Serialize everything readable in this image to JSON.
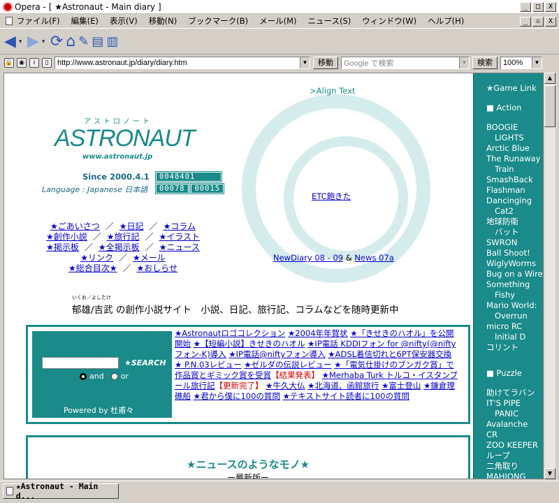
{
  "window": {
    "title": "Opera - [ ★Astronaut - Main diary ]",
    "min": "_",
    "max": "□",
    "close": "X",
    "child_min": "_",
    "child_restore": "▫",
    "child_close": "X"
  },
  "menu": [
    "ファイル(F)",
    "編集(E)",
    "表示(V)",
    "移動(N)",
    "ブックマーク(B)",
    "メール(M)",
    "ニュース(S)",
    "ウィンドウ(W)",
    "ヘルプ(H)"
  ],
  "address": {
    "url": "http://www.astronaut.jp/diary/diary.htm",
    "go_label": "移動",
    "search_placeholder": "Google で検索",
    "search_label": "検索",
    "zoom": "100%"
  },
  "page": {
    "align_text": ">Align Text",
    "logo_text": "ASTRONAUT",
    "logo_kana": "アストロノート",
    "logo_url": "www.astronaut.jp",
    "since": "Since 2000.4.1",
    "counter_total": "0048401",
    "language": "Language : Japanese 日本語",
    "counter_a": "00078",
    "counter_b": "00015",
    "etc_link": "ETC飽きた",
    "newdiary": "NewDiary 08 - 09",
    "amp": "&",
    "news07": "News 07a",
    "nav": [
      [
        "★ごあいさつ",
        "★日記",
        "★コラム"
      ],
      [
        "★創作小説",
        "★旅行記",
        "★イラスト"
      ],
      [
        "★掲示板",
        "★全掲示板",
        "★ニュース"
      ],
      [
        "★リンク",
        "★メール"
      ],
      [
        "★総合目次★",
        "★おしらせ"
      ]
    ],
    "sep": "／",
    "furigana": "いくお／よしたけ",
    "tagline_name": "郁雄/吉武",
    "tagline_rest": "の創作小説サイト　小説、日記、旅行記、コラムなどを随時更新中",
    "search_btn": "★SEARCH",
    "radio_and": "and",
    "radio_or": "or",
    "powered": "Powered by 杜甫々",
    "news_links": [
      "★Astronautロゴコレクション",
      "★2004年年賀状",
      "★「きせきのハオル」を公開開始",
      "★【短編小説】きせきのハオル",
      "★IP電話 KDDIフォン for @nifty(@niftyフォン-K)導入",
      "★IP電話@niftyフォン導入",
      "★ADSL着信切れと6PT保安器交換",
      "★ P.N.03レビュー",
      "★ゼルダの伝説レビュー",
      "★「電気仕掛けのブンガク賞」で作品賞とギミック賞を受賞",
      "★Merhaba Turk トルコ・イスタンブール旅行記",
      "★牛久大仏",
      "★北海道、函館旅行",
      "★富士登山",
      "★鎌倉理礁船",
      "★君から僕に100の質問",
      "★テキストサイト読者に100の質問"
    ],
    "news_red_a": "【結果発表】",
    "news_red_b": "【更新完了】",
    "news_title": "★ニュースのようなモノ★",
    "news_sub": "ー最新版ー"
  },
  "sidebar": {
    "game_link": "★Game Link",
    "action_hd": "■ Action",
    "action": [
      "BOOGIE",
      "  LIGHTS",
      "Arctic Blue",
      "The Runaway",
      "  Train",
      "SmashBack",
      "Flashman",
      "Dancinging",
      "  Cat2",
      "地球防衛",
      "  バット",
      "SWRON",
      "Ball Shoot!",
      "WiglyWorms",
      "Bug on a Wire",
      "Something",
      "  Fishy",
      "Mario World:",
      "  Overrun",
      "micro RC",
      "  Initial D",
      "コリント"
    ],
    "puzzle_hd": "■ Puzzle",
    "puzzle": [
      "助けてラバン",
      "IT'S PIPE",
      "  PANIC",
      "Avalanche",
      "CR",
      "ZOO KEEPER",
      "ループ",
      "二角取り",
      "MAHJONG"
    ]
  },
  "status": {
    "tab": "★Astronaut - Main d..."
  }
}
